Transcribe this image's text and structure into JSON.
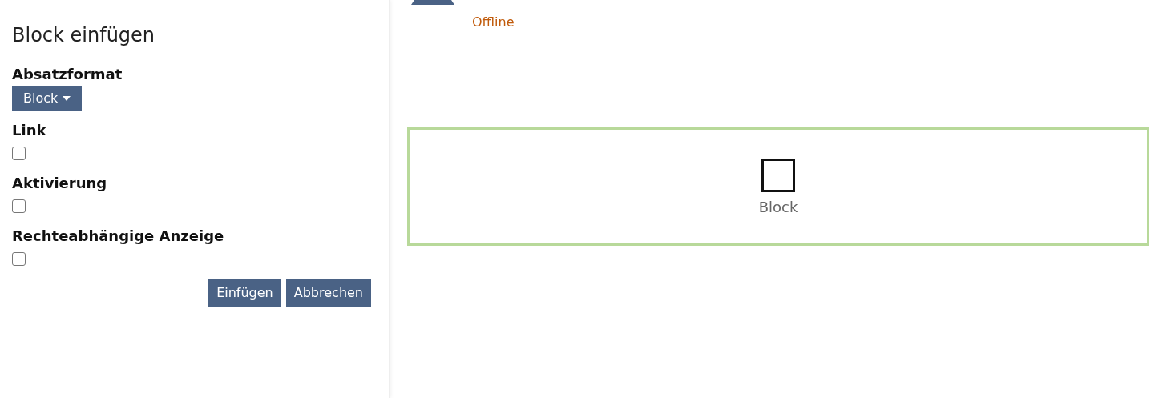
{
  "panel": {
    "title": "Block einfügen",
    "format": {
      "label": "Absatzformat",
      "value": "Block"
    },
    "options": [
      {
        "label": "Link",
        "checked": false
      },
      {
        "label": "Aktivierung",
        "checked": false
      },
      {
        "label": "Rechteabhängige Anzeige",
        "checked": false
      }
    ],
    "buttons": [
      "Einfügen",
      "Abbrechen"
    ]
  },
  "page": {
    "status": "Offline",
    "block": {
      "label": "Block"
    }
  }
}
